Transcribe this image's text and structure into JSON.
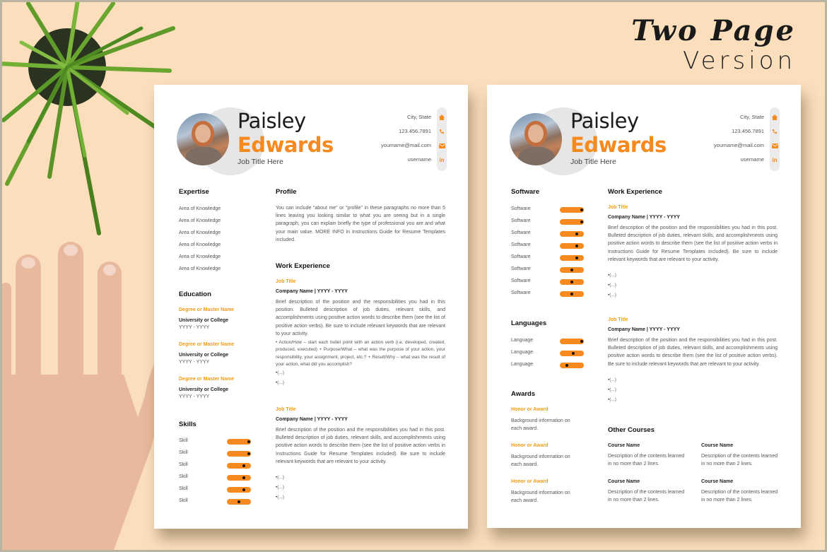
{
  "headline": {
    "line1": "Two Page",
    "line2": "Version"
  },
  "colors": {
    "accent": "#f68a1f",
    "background": "#fbdfbd",
    "page": "#ffffff",
    "text": "#222222"
  },
  "header": {
    "first_name": "Paisley",
    "last_name": "Edwards",
    "job_title": "Job Title Here",
    "contact": [
      {
        "text": "City, State",
        "icon": "home-icon"
      },
      {
        "text": "123.456.7891",
        "icon": "phone-icon"
      },
      {
        "text": "yourname@mail.com",
        "icon": "email-icon"
      },
      {
        "text": "username",
        "icon": "linkedin-icon"
      }
    ]
  },
  "page1": {
    "expertise": {
      "title": "Expertise",
      "items": [
        "Area of Knowledge",
        "Area of Knowledge",
        "Area of Knowledge",
        "Area of Knowledge",
        "Area of Knowledge",
        "Area of Knowledge"
      ]
    },
    "education": {
      "title": "Education",
      "items": [
        {
          "degree": "Degree or Master Name",
          "school": "University or College",
          "years": "YYYY - YYYY"
        },
        {
          "degree": "Degree or Master Name",
          "school": "University or College",
          "years": "YYYY - YYYY"
        },
        {
          "degree": "Degree or Master Name",
          "school": "University or College",
          "years": "YYYY - YYYY"
        }
      ]
    },
    "skills": {
      "title": "Skills",
      "items": [
        {
          "label": "Skill",
          "level": 0.9
        },
        {
          "label": "Skill",
          "level": 0.9
        },
        {
          "label": "Skill",
          "level": 0.7
        },
        {
          "label": "Skill",
          "level": 0.7
        },
        {
          "label": "Skill",
          "level": 0.7
        },
        {
          "label": "Skill",
          "level": 0.5
        }
      ]
    },
    "profile": {
      "title": "Profile",
      "text": "You can include \"about me\" or \"profile\" in these paragraphs no more than 5 lines leaving you looking similar to what you are seeing but in a single paragraph, you can explain briefly the type of professional you are and what your main value. MORE INFO in Instructions Guide for Resume Templates included."
    },
    "work": {
      "title": "Work Experience",
      "jobs": [
        {
          "title": "Job Title",
          "company": "Company Name  |  YYYY - YYYY",
          "description": "Brief description of the position and the responsibilities you had in this position. Bulleted description of job duties, relevant skills, and accomplishments using positive action words to describe them (see the list of positive action verbs). Be sure to include relevant keywords that are relevant to your activity.",
          "detail": "Action/How – start each bullet point with an action verb (i.e. developed, created, produced, executed) + Purpose/What – what was the purpose of your action, your responsibility, your assignment, project, etc.? + Result/Why – what was the result of your action, what did you accomplish?",
          "bullets": [
            "(...)",
            "(...)"
          ]
        },
        {
          "title": "Job Title",
          "company": "Company Name  |  YYYY - YYYY",
          "description": "Brief description of the position and the responsibilities you had in this post. Bulleted description of job duties, relevant skills, and accomplishments using positive action words to describe them (see the list of positive action verbs in Instructions Guide for Resume Templates included). Be sure to include relevant keywords that are relevant to your activity.",
          "bullets": [
            "(...)",
            "(...)",
            "(...)"
          ]
        }
      ]
    }
  },
  "page2": {
    "software": {
      "title": "Software",
      "items": [
        {
          "label": "Software",
          "level": 0.9
        },
        {
          "label": "Software",
          "level": 0.9
        },
        {
          "label": "Software",
          "level": 0.7
        },
        {
          "label": "Software",
          "level": 0.7
        },
        {
          "label": "Software",
          "level": 0.7
        },
        {
          "label": "Software",
          "level": 0.5
        },
        {
          "label": "Software",
          "level": 0.5
        },
        {
          "label": "Software",
          "level": 0.5
        }
      ]
    },
    "languages": {
      "title": "Languages",
      "items": [
        {
          "label": "Language",
          "level": 0.9
        },
        {
          "label": "Language",
          "level": 0.55
        },
        {
          "label": "Language",
          "level": 0.3
        }
      ]
    },
    "awards": {
      "title": "Awards",
      "items": [
        {
          "name": "Honor or Award",
          "text": "Background information on each award."
        },
        {
          "name": "Honor or Award",
          "text": "Background information on each award."
        },
        {
          "name": "Honor or Award",
          "text": "Background information on each award."
        }
      ]
    },
    "work": {
      "title": "Work Experience",
      "jobs": [
        {
          "title": "Job Title",
          "company": "Company Name  |  YYYY - YYYY",
          "description": "Brief description of the position and the responsibilities you had in this post. Bulleted description of job duties, relevant skills, and accomplishments using positive action words to describe them (see the list of positive action verbs in Instructions Guide for Resume Templates included). Be sure to include relevant keywords that are relevant to your activity.",
          "bullets": [
            "(...)",
            "(...)",
            "(...)"
          ]
        },
        {
          "title": "Job Title",
          "company": "Company Name  |  YYYY - YYYY",
          "description": "Brief description of the position and the responsibilities you had in this post. Bulleted description of job duties, relevant skills, and accomplishments using positive action words to describe them (see the list of positive action verbs). Be sure to include relevant keywords that are relevant to your activity.",
          "bullets": [
            "(...)",
            "(...)",
            "(...)"
          ]
        }
      ]
    },
    "courses": {
      "title": "Other Courses",
      "items": [
        {
          "name": "Course Name",
          "text": "Description of the contents learned in no more than 2 lines."
        },
        {
          "name": "Course Name",
          "text": "Description of the contents learned in no more than 2 lines."
        },
        {
          "name": "Course Name",
          "text": "Description of the contents learned in no more than 2 lines."
        },
        {
          "name": "Course Name",
          "text": "Description of the contents learned in no more than 2 lines."
        }
      ]
    }
  }
}
